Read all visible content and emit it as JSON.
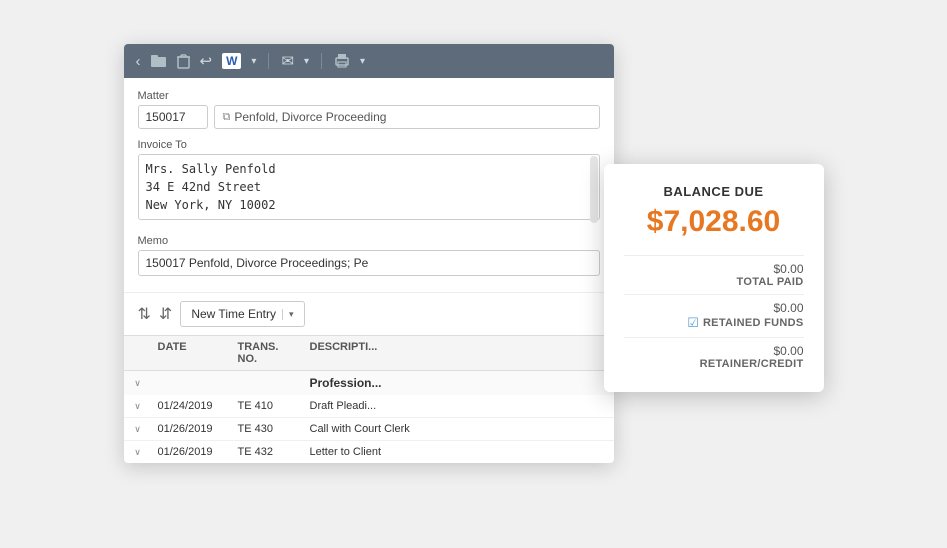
{
  "toolbar": {
    "back_label": "‹",
    "folder_icon": "📁",
    "delete_icon": "🗑",
    "undo_icon": "↩",
    "word_icon": "W",
    "email_icon": "✉",
    "print_icon": "🖨",
    "dropdown_arrow": "▾"
  },
  "form": {
    "matter_label": "Matter",
    "matter_number": "150017",
    "matter_link_icon": "⧉",
    "matter_description": "Penfold, Divorce Proceeding",
    "invoice_to_label": "Invoice To",
    "invoice_to_line1": "Mrs. Sally Penfold",
    "invoice_to_line2": "34 E 42nd Street",
    "invoice_to_line3": "New York, NY 10002",
    "memo_label": "Memo",
    "memo_value": "150017 Penfold, Divorce Proceedings; Pe"
  },
  "action_bar": {
    "sort_asc_icon": "⇅",
    "sort_desc_icon": "⇵",
    "new_entry_label": "New Time Entry",
    "dropdown_arrow": "▾"
  },
  "table": {
    "headers": [
      "",
      "DATE",
      "TRANS. NO.",
      "DESCRIPTI..."
    ],
    "group_row": {
      "label": "Profession..."
    },
    "rows": [
      {
        "chevron": "∨",
        "date": "01/24/2019",
        "trans": "TE 410",
        "desc": "Draft Pleadi..."
      },
      {
        "chevron": "∨",
        "date": "01/26/2019",
        "trans": "TE 430",
        "desc": "Call with Court Clerk"
      },
      {
        "chevron": "∨",
        "date": "01/26/2019",
        "trans": "TE 432",
        "desc": "Letter to Client"
      }
    ]
  },
  "balance_card": {
    "title": "BALANCE DUE",
    "amount": "$7,028.60",
    "total_paid_value": "$0.00",
    "total_paid_label": "TOTAL PAID",
    "retained_value": "$0.00",
    "retained_label": "RETAINED FUNDS",
    "retainer_value": "$0.00",
    "retainer_label": "RETAINER/CREDIT"
  }
}
